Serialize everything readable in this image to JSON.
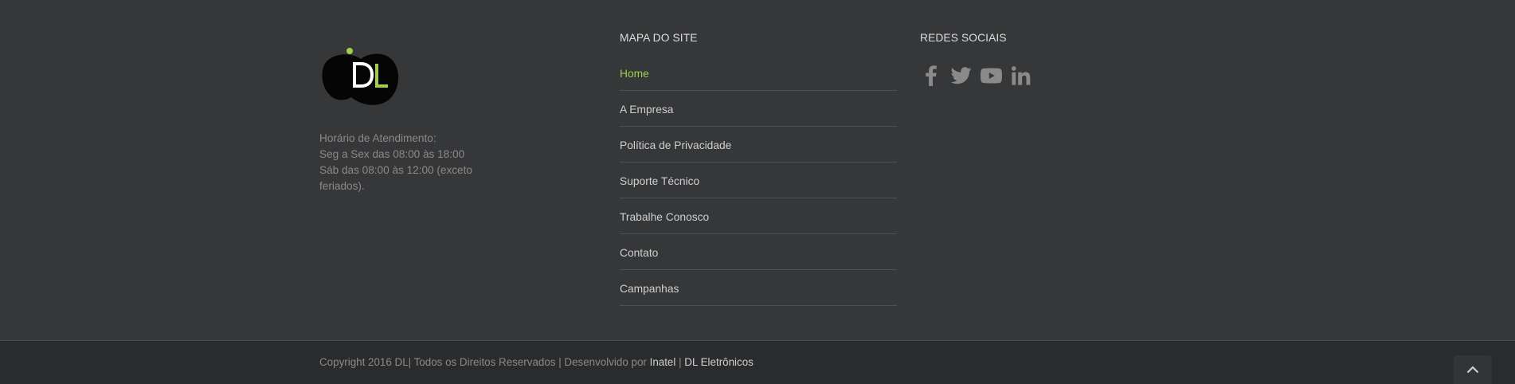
{
  "about": {
    "logo_text": "DL",
    "hours": [
      "Horário de Atendimento:",
      "Seg a Sex das 08:00 às 18:00",
      "Sáb das 08:00 às 12:00 (exceto",
      "feriados)."
    ]
  },
  "sitemap": {
    "title": "MAPA DO SITE",
    "items": [
      {
        "label": "Home",
        "active": true
      },
      {
        "label": "A Empresa"
      },
      {
        "label": "Política de Privacidade"
      },
      {
        "label": "Suporte Técnico"
      },
      {
        "label": "Trabalhe Conosco"
      },
      {
        "label": "Contato"
      },
      {
        "label": "Campanhas"
      }
    ]
  },
  "social": {
    "title": "REDES SOCIAIS",
    "icons": [
      "facebook-icon",
      "twitter-icon",
      "youtube-icon",
      "linkedin-icon"
    ]
  },
  "copyright": {
    "text": "Copyright 2016 DL| Todos os Direitos Reservados | Desenvolvido por ",
    "link1": "Inatel",
    "sep": " | ",
    "link2": "DL Eletrônicos"
  },
  "colors": {
    "accent": "#a0ce4e",
    "background": "#363739",
    "bottom_bar": "#2a2b2d"
  }
}
